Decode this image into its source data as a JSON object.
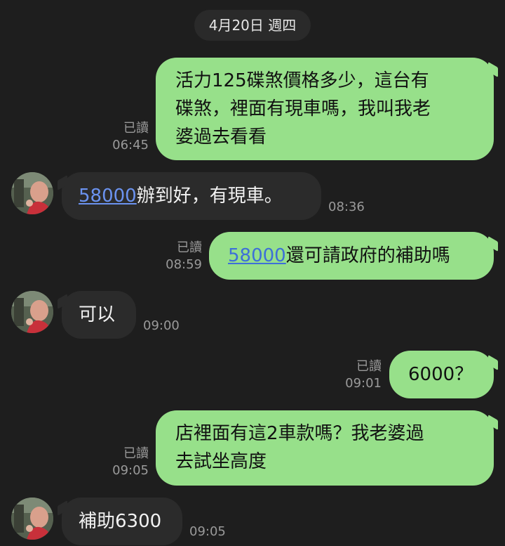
{
  "date_divider": "4月20日 週四",
  "messages": [
    {
      "direction": "out",
      "lines": [
        "活力125碟煞價格多少，這台有",
        "碟煞，裡面有現車嗎，我叫我老",
        "婆過去看看"
      ],
      "read_label": "已讀",
      "time": "06:45"
    },
    {
      "direction": "in",
      "link_text": "58000",
      "text": "辦到好，有現車。",
      "time": "08:36"
    },
    {
      "direction": "out",
      "link_text": "58000",
      "text": "還可請政府的補助嗎",
      "read_label": "已讀",
      "time": "08:59"
    },
    {
      "direction": "in",
      "text": "可以",
      "time": "09:00"
    },
    {
      "direction": "out",
      "text": "6000？",
      "read_label": "已讀",
      "time": "09:01"
    },
    {
      "direction": "out",
      "lines": [
        "店裡面有這2車款嗎？我老婆過",
        "去試坐高度"
      ],
      "read_label": "已讀",
      "time": "09:05"
    },
    {
      "direction": "in",
      "text": "補助6300",
      "time": "09:05"
    }
  ],
  "colors": {
    "background": "#1e1e1e",
    "outgoing_bubble": "#97e08a",
    "incoming_bubble": "#2b2b2b",
    "link": "#3d6fd8",
    "meta_text": "#9a9a9a"
  },
  "icons": {
    "avatar": "contact-avatar-photo"
  }
}
